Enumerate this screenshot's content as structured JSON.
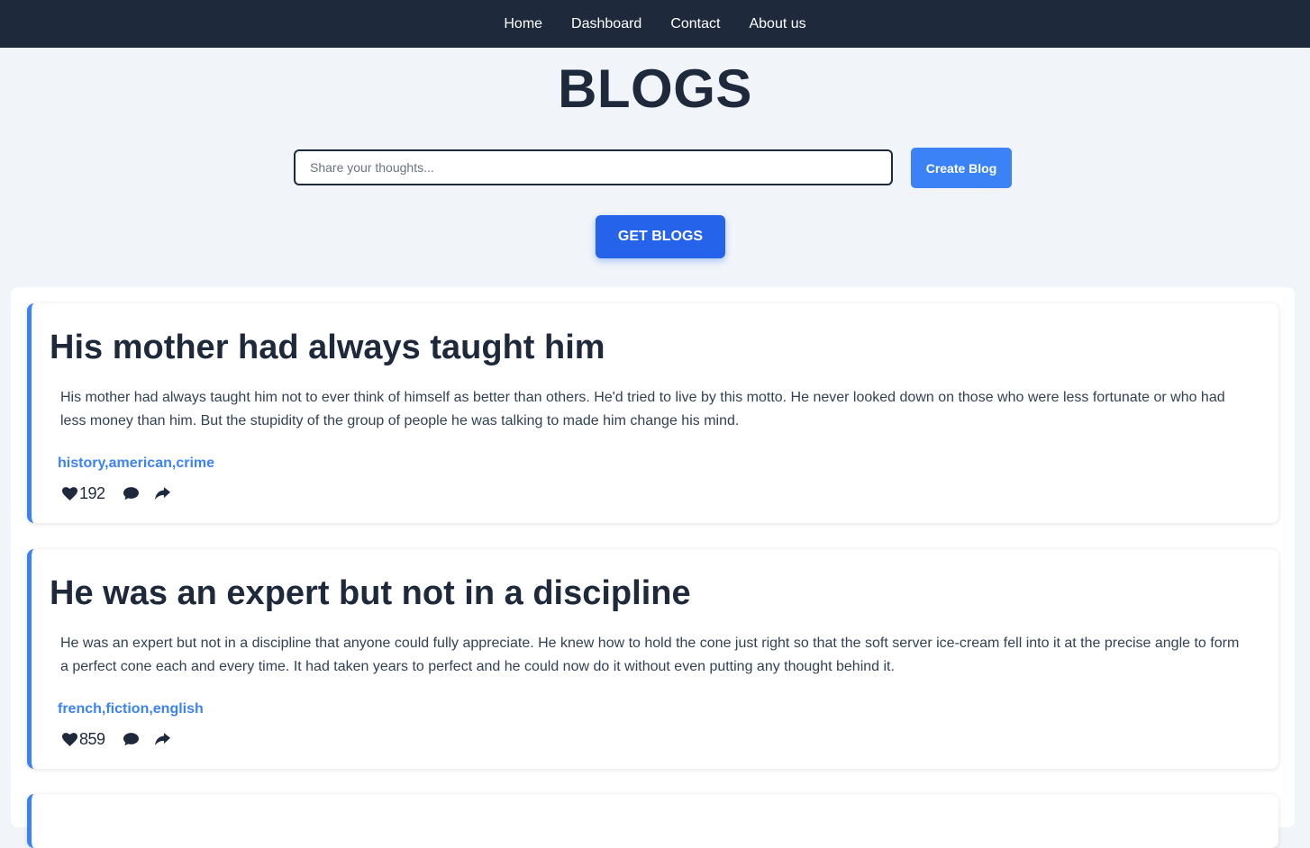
{
  "nav": {
    "items": [
      "Home",
      "Dashboard",
      "Contact",
      "About us"
    ]
  },
  "page": {
    "title": "BLOGS"
  },
  "compose": {
    "placeholder": "Share your thoughts...",
    "value": "",
    "create_label": "Create Blog"
  },
  "get_blogs_label": "GET BLOGS",
  "posts": [
    {
      "title": "His mother had always taught him",
      "body": "His mother had always taught him not to ever think of himself as better than others. He'd tried to live by this motto. He never looked down on those who were less fortunate or who had less money than him. But the stupidity of the group of people he was talking to made him change his mind.",
      "tags": "history,american,crime",
      "likes": "192"
    },
    {
      "title": "He was an expert but not in a discipline",
      "body": "He was an expert but not in a discipline that anyone could fully appreciate. He knew how to hold the cone just right so that the soft server ice-cream fell into it at the precise angle to form a perfect cone each and every time. It had taken years to perfect and he could now do it without even putting any thought behind it.",
      "tags": "french,fiction,english",
      "likes": "859"
    }
  ],
  "icons": {
    "like": "heart-icon",
    "comment": "comment-icon",
    "share": "share-icon"
  },
  "colors": {
    "nav_bg": "#1e293b",
    "page_bg": "#f1f5f9",
    "accent": "#3b82f6",
    "primary_button": "#2563eb",
    "text": "#1e293b"
  }
}
